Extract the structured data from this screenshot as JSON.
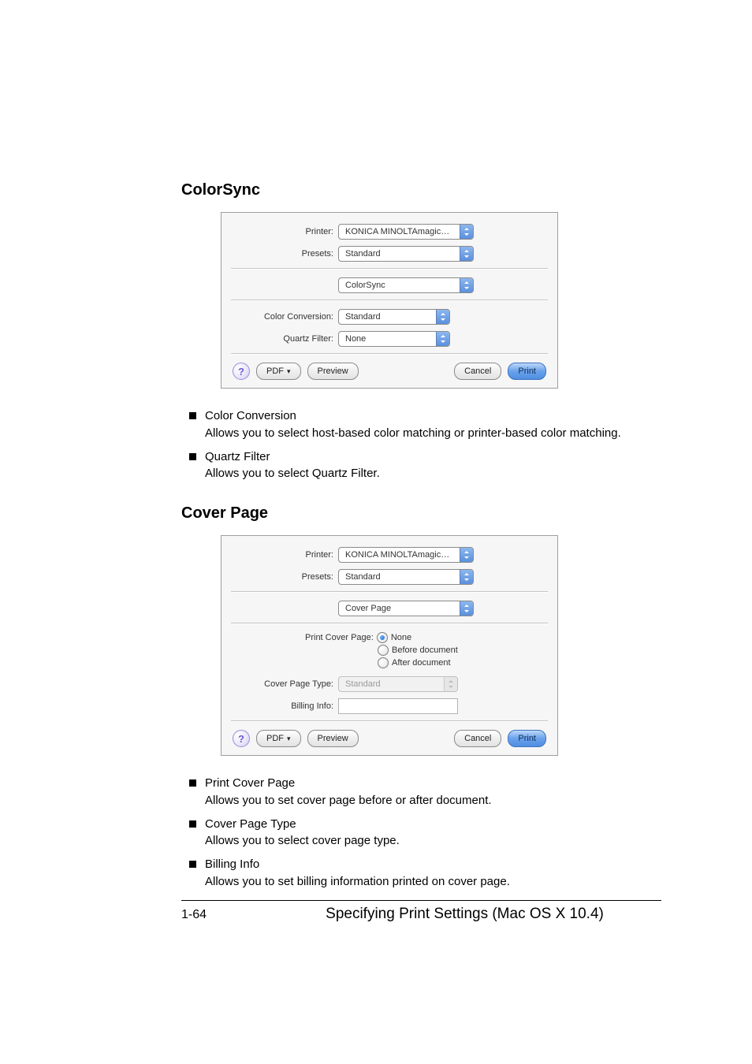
{
  "section1": {
    "heading": "ColorSync",
    "dialog": {
      "rows": {
        "printer_label": "Printer:",
        "printer_value": "KONICA MINOLTAmagicolor 1...",
        "presets_label": "Presets:",
        "presets_value": "Standard",
        "pane_value": "ColorSync",
        "color_conversion_label": "Color Conversion:",
        "color_conversion_value": "Standard",
        "quartz_filter_label": "Quartz Filter:",
        "quartz_filter_value": "None"
      },
      "footer": {
        "help": "?",
        "pdf": "PDF",
        "preview": "Preview",
        "cancel": "Cancel",
        "print": "Print"
      }
    },
    "features": [
      {
        "title": "Color Conversion",
        "desc": "Allows you to select host-based color matching or printer-based color matching."
      },
      {
        "title": "Quartz Filter",
        "desc": "Allows you to select Quartz Filter."
      }
    ]
  },
  "section2": {
    "heading": "Cover Page",
    "dialog": {
      "rows": {
        "printer_label": "Printer:",
        "printer_value": "KONICA MINOLTAmagicolor 1...",
        "presets_label": "Presets:",
        "presets_value": "Standard",
        "pane_value": "Cover Page",
        "print_cover_page_label": "Print Cover Page:",
        "radio_none": "None",
        "radio_before": "Before document",
        "radio_after": "After document",
        "cover_page_type_label": "Cover Page Type:",
        "cover_page_type_value": "Standard",
        "billing_info_label": "Billing Info:"
      },
      "footer": {
        "help": "?",
        "pdf": "PDF",
        "preview": "Preview",
        "cancel": "Cancel",
        "print": "Print"
      }
    },
    "features": [
      {
        "title": "Print Cover Page",
        "desc": "Allows you to set cover page before or after document."
      },
      {
        "title": "Cover Page Type",
        "desc": "Allows you to select cover page type."
      },
      {
        "title": "Billing Info",
        "desc": "Allows you to set billing information printed on cover page."
      }
    ]
  },
  "page_footer": {
    "number": "1-64",
    "title": "Specifying Print Settings (Mac OS X 10.4)"
  }
}
